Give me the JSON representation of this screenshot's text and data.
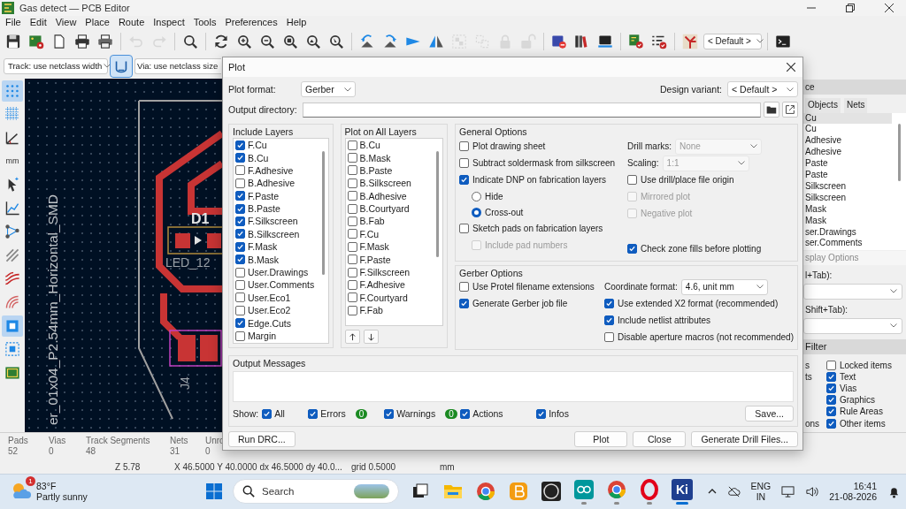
{
  "window": {
    "title": "Gas detect — PCB Editor"
  },
  "menu": [
    "File",
    "Edit",
    "View",
    "Place",
    "Route",
    "Inspect",
    "Tools",
    "Preferences",
    "Help"
  ],
  "toolbar": {
    "groups": [
      [
        {
          "disabled": false
        },
        {
          "disabled": false
        },
        {
          "disabled": false
        },
        {
          "disabled": false
        },
        {
          "disabled": false
        }
      ],
      [
        {
          "disabled": true
        },
        {
          "disabled": true
        }
      ],
      [
        {
          "disabled": false
        }
      ],
      [
        {
          "disabled": false
        },
        {
          "disabled": false
        },
        {
          "disabled": false
        },
        {
          "disabled": false
        },
        {
          "disabled": false
        },
        {
          "disabled": false
        }
      ],
      [
        {
          "disabled": false
        },
        {
          "disabled": false
        },
        {
          "disabled": false
        },
        {
          "disabled": false
        },
        {
          "disabled": true
        },
        {
          "disabled": true
        },
        {
          "disabled": true
        },
        {
          "disabled": true
        }
      ],
      [
        {
          "disabled": false
        },
        {
          "disabled": false
        },
        {
          "disabled": false
        }
      ],
      [
        {
          "disabled": false
        },
        {
          "disabled": false
        }
      ],
      [
        {
          "disabled": false
        }
      ],
      [
        {
          "disabled": false
        }
      ]
    ],
    "preset": "< Default >"
  },
  "track_width": "Track: use netclass width",
  "netclass_toggle": {
    "selected": true
  },
  "via_size": "Via: use netclass size",
  "left_tools": [
    {
      "selected": true
    },
    {
      "selected": false
    },
    {
      "selected": false
    },
    {
      "selected": false,
      "label": "mm"
    },
    {
      "selected": false
    },
    {
      "selected": false
    },
    {
      "selected": false
    },
    {
      "selected": false
    },
    {
      "selected": false
    },
    {
      "selected": false
    },
    {
      "selected": true
    },
    {
      "selected": false
    },
    {
      "selected": false
    }
  ],
  "canvas": {
    "labels": [
      {
        "kind": "reference",
        "text": "D1"
      },
      {
        "kind": "value",
        "text": "LED_12"
      },
      {
        "kind": "footprint",
        "text": "er_01x04_P2.54mm_Horizontal_SMD"
      },
      {
        "kind": "reference_vertical",
        "text": "J4"
      }
    ]
  },
  "right_panel": {
    "header": "ce",
    "tabs": [
      {
        "label": "Objects",
        "selected": false
      },
      {
        "label": "Nets",
        "selected": false
      }
    ],
    "layers": [
      {
        "name": "Cu",
        "selected": true
      },
      {
        "name": "Cu",
        "selected": false
      },
      {
        "name": "Adhesive",
        "selected": false
      },
      {
        "name": "Adhesive",
        "selected": false
      },
      {
        "name": "Paste",
        "selected": false
      },
      {
        "name": "Paste",
        "selected": false
      },
      {
        "name": "Silkscreen",
        "selected": false
      },
      {
        "name": "Silkscreen",
        "selected": false
      },
      {
        "name": "Mask",
        "selected": false
      },
      {
        "name": "Mask",
        "selected": false
      },
      {
        "name": "ser.Drawings",
        "selected": false
      },
      {
        "name": "ser.Comments",
        "selected": false
      }
    ],
    "display_options": "splay Options",
    "preset_label": "l+Tab):",
    "viewport_label": "Shift+Tab):",
    "filter_title": "Filter",
    "filters": [
      {
        "left": "s",
        "label": "Locked items",
        "checked": false
      },
      {
        "left": "ts",
        "label": "Text",
        "checked": true
      },
      {
        "label": "Vias",
        "checked": true
      },
      {
        "label": "Graphics",
        "checked": true
      },
      {
        "label": "Rule Areas",
        "checked": true
      },
      {
        "left": "ons",
        "label": "Other items",
        "checked": true
      }
    ]
  },
  "status": {
    "stats": [
      {
        "label": "Pads",
        "value": "52"
      },
      {
        "label": "Vias",
        "value": "0"
      },
      {
        "label": "Track Segments",
        "value": "48"
      },
      {
        "label": "Nets",
        "value": "31"
      },
      {
        "label": "Unro",
        "value": "0"
      }
    ],
    "zoom": "Z 5.78",
    "coords": "X 46.5000 Y 40.0000 dx 46.5000 dy 40.0...",
    "grid": "grid 0.5000",
    "units": "mm"
  },
  "dialog": {
    "title": "Plot",
    "plot_format": {
      "label": "Plot format:",
      "value": "Gerber"
    },
    "design_variant": {
      "label": "Design variant:",
      "value": "< Default >"
    },
    "output_directory": {
      "label": "Output directory:"
    },
    "include_layers": {
      "title": "Include Layers",
      "items": [
        {
          "label": "F.Cu",
          "checked": true
        },
        {
          "label": "B.Cu",
          "checked": true
        },
        {
          "label": "F.Adhesive",
          "checked": false
        },
        {
          "label": "B.Adhesive",
          "checked": false
        },
        {
          "label": "F.Paste",
          "checked": true
        },
        {
          "label": "B.Paste",
          "checked": true
        },
        {
          "label": "F.Silkscreen",
          "checked": true
        },
        {
          "label": "B.Silkscreen",
          "checked": true
        },
        {
          "label": "F.Mask",
          "checked": true
        },
        {
          "label": "B.Mask",
          "checked": true
        },
        {
          "label": "User.Drawings",
          "checked": false
        },
        {
          "label": "User.Comments",
          "checked": false
        },
        {
          "label": "User.Eco1",
          "checked": false
        },
        {
          "label": "User.Eco2",
          "checked": false
        },
        {
          "label": "Edge.Cuts",
          "checked": true
        },
        {
          "label": "Margin",
          "checked": false
        }
      ]
    },
    "plot_on_all_layers": {
      "title": "Plot on All Layers",
      "items": [
        {
          "label": "B.Cu",
          "checked": false
        },
        {
          "label": "B.Mask",
          "checked": false
        },
        {
          "label": "B.Paste",
          "checked": false
        },
        {
          "label": "B.Silkscreen",
          "checked": false
        },
        {
          "label": "B.Adhesive",
          "checked": false
        },
        {
          "label": "B.Courtyard",
          "checked": false
        },
        {
          "label": "B.Fab",
          "checked": false
        },
        {
          "label": "F.Cu",
          "checked": false
        },
        {
          "label": "F.Mask",
          "checked": false
        },
        {
          "label": "F.Paste",
          "checked": false
        },
        {
          "label": "F.Silkscreen",
          "checked": false
        },
        {
          "label": "F.Adhesive",
          "checked": false
        },
        {
          "label": "F.Courtyard",
          "checked": false
        },
        {
          "label": "F.Fab",
          "checked": false
        }
      ]
    },
    "general_options": {
      "title": "General Options",
      "left": [
        {
          "kind": "checkbox",
          "label": "Plot drawing sheet",
          "checked": false,
          "disabled": false
        },
        {
          "kind": "checkbox",
          "label": "Subtract soldermask from silkscreen",
          "checked": false,
          "disabled": false
        },
        {
          "kind": "checkbox",
          "label": "Indicate DNP on fabrication layers",
          "checked": true,
          "disabled": false,
          "children": [
            {
              "kind": "radio",
              "label": "Hide",
              "selected": false
            },
            {
              "kind": "radio",
              "label": "Cross-out",
              "selected": true
            }
          ]
        },
        {
          "kind": "checkbox",
          "label": "Sketch pads on fabrication layers",
          "checked": false,
          "disabled": false,
          "children": [
            {
              "kind": "checkbox",
              "label": "Include pad numbers",
              "checked": false,
              "disabled": true
            }
          ]
        }
      ],
      "right": [
        {
          "kind": "select",
          "label": "Drill marks:",
          "value": "None",
          "disabled": true
        },
        {
          "kind": "select",
          "label": "Scaling:",
          "value": "1:1",
          "disabled": true
        },
        {
          "kind": "checkbox",
          "label": "Use drill/place file origin",
          "checked": false,
          "disabled": false
        },
        {
          "kind": "checkbox",
          "label": "Mirrored plot",
          "checked": false,
          "disabled": true
        },
        {
          "kind": "checkbox",
          "label": "Negative plot",
          "checked": false,
          "disabled": true
        },
        {
          "kind": "checkbox",
          "label": "Check zone fills before plotting",
          "checked": true,
          "disabled": false
        }
      ]
    },
    "gerber_options": {
      "title": "Gerber Options",
      "left": [
        {
          "kind": "checkbox",
          "label": "Use Protel filename extensions",
          "checked": false
        },
        {
          "kind": "checkbox",
          "label": "Generate Gerber job file",
          "checked": true
        }
      ],
      "right": [
        {
          "kind": "select",
          "label": "Coordinate format:",
          "value": "4.6, unit mm"
        },
        {
          "kind": "checkbox",
          "label": "Use extended X2 format (recommended)",
          "checked": true
        },
        {
          "kind": "checkbox",
          "label": "Include netlist attributes",
          "checked": true
        },
        {
          "kind": "checkbox",
          "label": "Disable aperture macros (not recommended)",
          "checked": false
        }
      ]
    },
    "output_messages": {
      "title": "Output Messages",
      "show_label": "Show:",
      "filters": [
        {
          "label": "All",
          "checked": true
        },
        {
          "label": "Errors",
          "checked": true,
          "count": "0"
        },
        {
          "label": "Warnings",
          "checked": true,
          "count": "0"
        },
        {
          "label": "Actions",
          "checked": true
        },
        {
          "label": "Infos",
          "checked": true
        }
      ],
      "save": "Save..."
    },
    "buttons": {
      "left": [
        "Run DRC..."
      ],
      "right": [
        "Plot",
        "Close",
        "Generate Drill Files..."
      ]
    }
  },
  "taskbar": {
    "weather": {
      "badge": "1",
      "temp": "83°F",
      "condition": "Partly sunny"
    },
    "search": {
      "placeholder": "Search"
    },
    "apps": [
      {
        "kind": "task-view",
        "running": false,
        "active": false
      },
      {
        "kind": "folder",
        "running": false,
        "active": false
      },
      {
        "kind": "color-circle",
        "running": false,
        "active": false
      },
      {
        "kind": "rounded-square",
        "running": false,
        "active": false
      },
      {
        "kind": "dark-circle",
        "running": false,
        "active": false
      },
      {
        "kind": "infinity",
        "running": true,
        "active": false
      },
      {
        "kind": "color-circle",
        "running": true,
        "active": false
      },
      {
        "kind": "ring",
        "running": true,
        "active": false
      },
      {
        "kind": "ki-tile",
        "label": "Ki",
        "running": true,
        "active": true
      }
    ],
    "tray": {
      "lang": "ENG",
      "region": "IN",
      "time": "16:41",
      "date": "21-08-2026"
    }
  }
}
